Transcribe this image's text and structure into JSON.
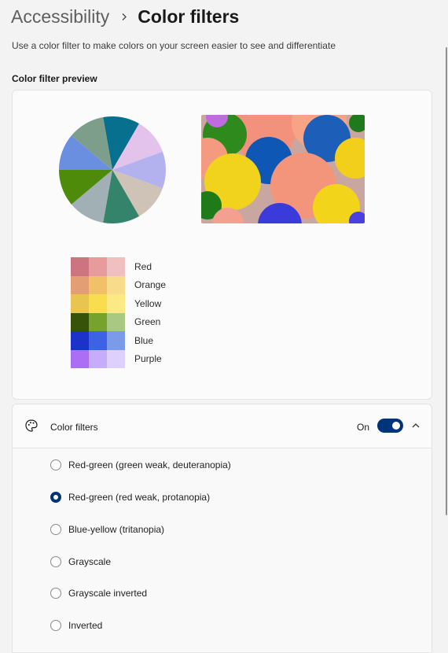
{
  "breadcrumb": {
    "parent": "Accessibility",
    "current": "Color filters"
  },
  "description": "Use a color filter to make colors on your screen easier to see and differentiate",
  "preview": {
    "heading": "Color filter preview",
    "pie_slice_colors": [
      "#07708e",
      "#e3c3ec",
      "#b3b2ef",
      "#cfc2b7",
      "#34836b",
      "#a0b0b4",
      "#4e8b0a",
      "#6b8fe0",
      "#7d9e8a"
    ],
    "swatches": [
      {
        "label": "Red",
        "colors": [
          "#cc7580",
          "#e89b9c",
          "#f0c0c1"
        ]
      },
      {
        "label": "Orange",
        "colors": [
          "#e39f73",
          "#f1c16a",
          "#f8dc8b"
        ]
      },
      {
        "label": "Yellow",
        "colors": [
          "#e8c54f",
          "#f8de4e",
          "#fbea83"
        ]
      },
      {
        "label": "Green",
        "colors": [
          "#37530a",
          "#78a22e",
          "#a9c882"
        ]
      },
      {
        "label": "Blue",
        "colors": [
          "#1c32c9",
          "#3d62e4",
          "#7b9be8"
        ]
      },
      {
        "label": "Purple",
        "colors": [
          "#ab6ff6",
          "#c6adfb",
          "#ddd0fc"
        ]
      }
    ]
  },
  "color_filters": {
    "label": "Color filters",
    "state_label": "On",
    "enabled": true,
    "accent_color": "#00347a",
    "options": [
      {
        "label": "Red-green (green weak, deuteranopia)",
        "selected": false
      },
      {
        "label": "Red-green (red weak, protanopia)",
        "selected": true
      },
      {
        "label": "Blue-yellow (tritanopia)",
        "selected": false
      },
      {
        "label": "Grayscale",
        "selected": false
      },
      {
        "label": "Grayscale inverted",
        "selected": false
      },
      {
        "label": "Inverted",
        "selected": false
      }
    ]
  }
}
